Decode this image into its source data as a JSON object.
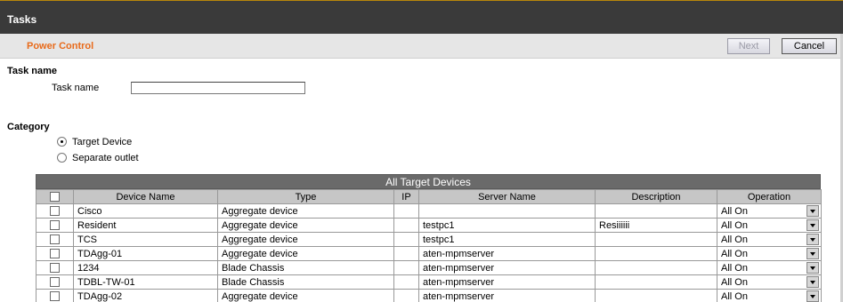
{
  "header": {
    "title": "Tasks"
  },
  "subheader": {
    "section": "Power Control",
    "next_label": "Next",
    "cancel_label": "Cancel"
  },
  "task": {
    "heading": "Task name",
    "field_label": "Task name",
    "value": ""
  },
  "category": {
    "heading": "Category",
    "options": [
      {
        "label": "Target Device",
        "selected": true
      },
      {
        "label": "Separate outlet",
        "selected": false
      }
    ]
  },
  "devices": {
    "caption": "All Target Devices",
    "columns": [
      "Device Name",
      "Type",
      "IP",
      "Server Name",
      "Description",
      "Operation"
    ],
    "rows": [
      {
        "name": "Cisco",
        "type": "Aggregate device",
        "ip": "",
        "server": "",
        "description": "",
        "operation": "All On"
      },
      {
        "name": "Resident",
        "type": "Aggregate device",
        "ip": "",
        "server": "testpc1",
        "description": "Resiiiiii",
        "operation": "All On"
      },
      {
        "name": "TCS",
        "type": "Aggregate device",
        "ip": "",
        "server": "testpc1",
        "description": "",
        "operation": "All On"
      },
      {
        "name": "TDAgg-01",
        "type": "Aggregate device",
        "ip": "",
        "server": "aten-mpmserver",
        "description": "",
        "operation": "All On"
      },
      {
        "name": "1234",
        "type": "Blade Chassis",
        "ip": "",
        "server": "aten-mpmserver",
        "description": "",
        "operation": "All On"
      },
      {
        "name": "TDBL-TW-01",
        "type": "Blade Chassis",
        "ip": "",
        "server": "aten-mpmserver",
        "description": "",
        "operation": "All On"
      },
      {
        "name": "TDAgg-02",
        "type": "Aggregate device",
        "ip": "",
        "server": "aten-mpmserver",
        "description": "",
        "operation": "All On"
      }
    ]
  }
}
